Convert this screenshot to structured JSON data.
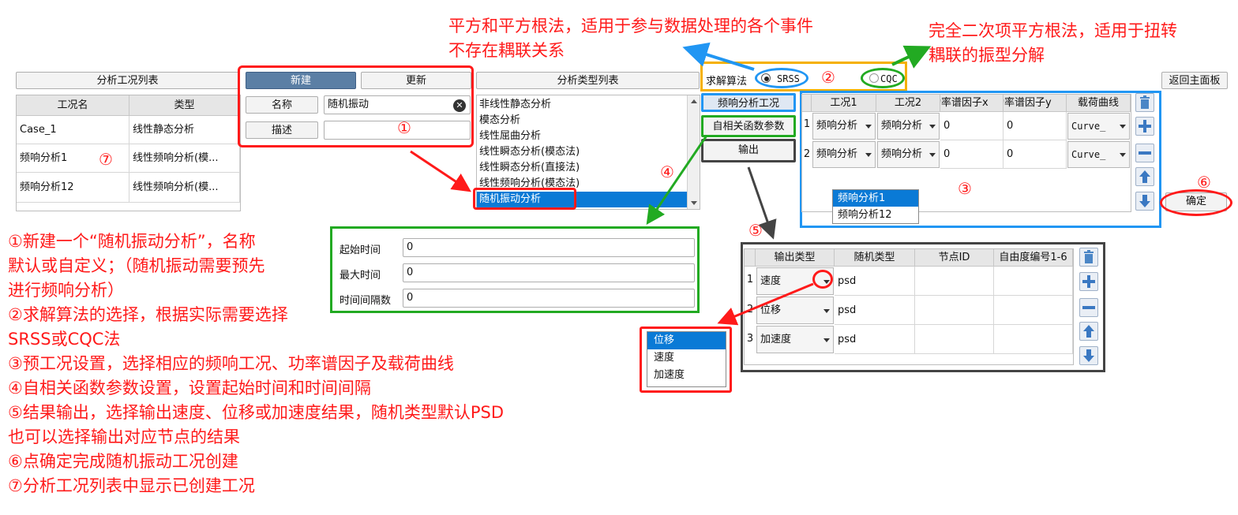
{
  "left_panel": {
    "title": "分析工况列表",
    "columns": [
      "工况名",
      "类型"
    ],
    "rows": [
      {
        "name": "Case_1",
        "type": "线性静态分析"
      },
      {
        "name": "频响分析1",
        "type": "线性频响分析(模..."
      },
      {
        "name": "频响分析12",
        "type": "线性频响分析(模..."
      }
    ]
  },
  "new_case": {
    "new_label": "新建",
    "update_label": "更新",
    "name_label": "名称",
    "name_value": "随机振动",
    "desc_label": "描述",
    "desc_value": ""
  },
  "analysis_types": {
    "title": "分析类型列表",
    "items": [
      "非线性静态分析",
      "模态分析",
      "线性屈曲分析",
      "线性瞬态分析(模态法)",
      "线性瞬态分析(直接法)",
      "线性频响分析(模态法)",
      "随机振动分析"
    ],
    "selected_index": 6
  },
  "solver": {
    "label": "求解算法",
    "srss": "SRSS",
    "cqc": "CQC",
    "selected": "SRSS"
  },
  "return_label": "返回主面板",
  "tabs": {
    "freq": "频响分析工况",
    "autocorr": "自相关函数参数",
    "output": "输出"
  },
  "freq_table": {
    "columns": [
      "工况1",
      "工况2",
      "功率谱因子x",
      "功率谱因子y",
      "载荷曲线"
    ],
    "rows": [
      {
        "no": "1",
        "c1": "频响分析",
        "c2": "频响分析",
        "x": "0",
        "y": "0",
        "curve": "Curve_"
      },
      {
        "no": "2",
        "c1": "频响分析",
        "c2": "频响分析",
        "x": "0",
        "y": "0",
        "curve": "Curve_"
      }
    ],
    "dropdown": [
      "频响分析1",
      "频响分析12"
    ]
  },
  "confirm_label": "确定",
  "autocorr_params": {
    "start_label": "起始时间",
    "start_value": "0",
    "max_label": "最大时间",
    "max_value": "0",
    "interval_label": "时间间隔数",
    "interval_value": "0"
  },
  "output_table": {
    "columns": [
      "输出类型",
      "随机类型",
      "节点ID",
      "自由度编号1-6"
    ],
    "rows": [
      {
        "no": "1",
        "type": "速度",
        "rand": "psd"
      },
      {
        "no": "2",
        "type": "位移",
        "rand": "psd"
      },
      {
        "no": "3",
        "type": "加速度",
        "rand": "psd"
      }
    ],
    "dropdown": [
      "位移",
      "速度",
      "加速度"
    ]
  },
  "annotations": {
    "srss_note_1": "平方和平方根法，适用于参与数据处理的各个事件",
    "srss_note_2": "不存在耦联关系",
    "cqc_note_1": "完全二次项平方根法，适用于扭转",
    "cqc_note_2": "耦联的振型分解",
    "n1": "①",
    "n2": "②",
    "n3": "③",
    "n4": "④",
    "n5": "⑤",
    "n6": "⑥",
    "n7": "⑦",
    "steps": [
      "①新建一个“随机振动分析”，名称",
      "默认或自定义；（随机振动需要预先",
      "进行频响分析）",
      "②求解算法的选择，根据实际需要选择",
      "SRSS或CQC法",
      "③预工况设置，选择相应的频响工况、功率谱因子及载荷曲线",
      "④自相关函数参数设置，设置起始时间和时间间隔",
      "⑤结果输出，选择输出速度、位移或加速度结果，随机类型默认PSD",
      "也可以选择输出对应节点的结果",
      "⑥点确定完成随机振动工况创建",
      "⑦分析工况列表中显示已创建工况"
    ]
  },
  "colors": {
    "annotation_red": "#ff1a1a",
    "highlight_orange": "#f5b000",
    "highlight_blue": "#2196f3",
    "highlight_green": "#22aa22",
    "highlight_dark": "#444444",
    "selection_blue": "#0a7ad6",
    "button_dark": "#5b7fa5"
  }
}
